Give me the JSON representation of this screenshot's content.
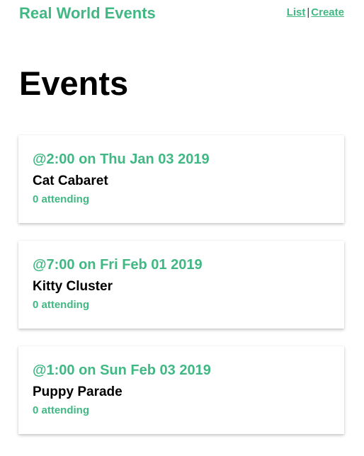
{
  "nav": {
    "brand": "Real World Events",
    "links": {
      "list": "List",
      "separator": "|",
      "create": "Create"
    }
  },
  "page": {
    "title": "Events"
  },
  "events": [
    {
      "time": "@2:00 on Thu Jan 03 2019",
      "title": "Cat Cabaret",
      "attending": "0 attending"
    },
    {
      "time": "@7:00 on Fri Feb 01 2019",
      "title": "Kitty Cluster",
      "attending": "0 attending"
    },
    {
      "time": "@1:00 on Sun Feb 03 2019",
      "title": "Puppy Parade",
      "attending": "0 attending"
    }
  ],
  "colors": {
    "accent": "#41b883",
    "text": "#000000",
    "separator": "#2c3e50",
    "card_background": "#ffffff"
  }
}
